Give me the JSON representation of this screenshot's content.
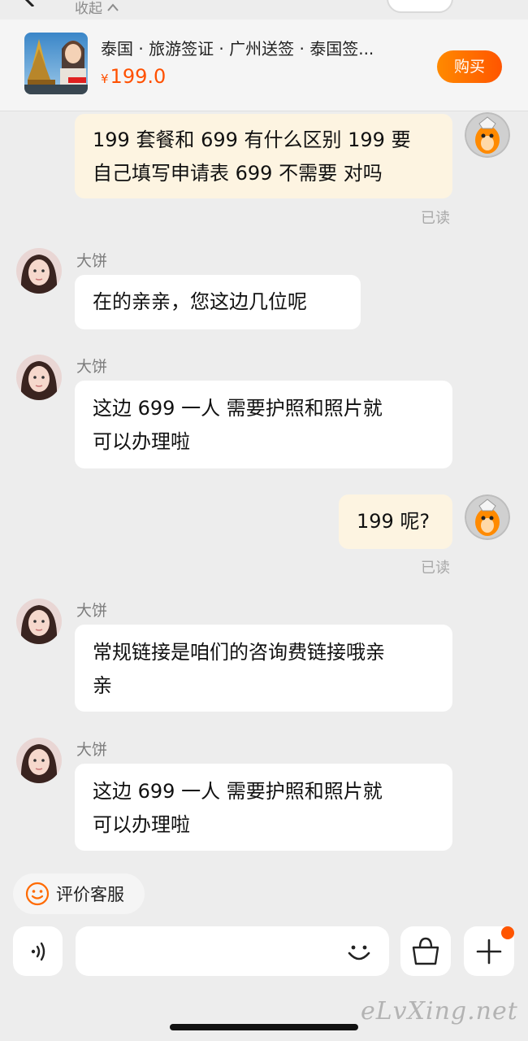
{
  "header": {
    "collapse_label": "收起"
  },
  "product": {
    "title": "泰国 · 旅游签证 · 广州送签 · 泰国签...",
    "currency": "¥",
    "price": "199.0",
    "buy_label": "购买",
    "thumb_caption": "泰国旅游签证"
  },
  "messages": [
    {
      "side": "out",
      "lines": [
        "199 套餐和 699 有什么区别 199 要",
        "自己填写申请表 699 不需要 对吗"
      ],
      "status": "已读"
    },
    {
      "side": "in",
      "sender": "大饼",
      "lines": [
        "在的亲亲，您这边几位呢"
      ]
    },
    {
      "side": "in",
      "sender": "大饼",
      "lines": [
        "这边 699 一人 需要护照和照片就",
        "可以办理啦"
      ]
    },
    {
      "side": "out",
      "lines": [
        "199 呢?"
      ],
      "status": "已读"
    },
    {
      "side": "in",
      "sender": "大饼",
      "lines": [
        "常规链接是咱们的咨询费链接哦亲",
        "亲"
      ]
    },
    {
      "side": "in",
      "sender": "大饼",
      "lines": [
        "这边 699 一人 需要护照和照片就",
        "可以办理啦"
      ]
    }
  ],
  "rate_chip": {
    "label": "评价客服",
    "icon": "smiley-icon"
  },
  "input_bar": {
    "icons": [
      "voice-icon",
      "emoji-icon",
      "shopping-bag-icon",
      "plus-icon"
    ],
    "accent": "#ff5500"
  },
  "watermark": "eLvXing.net",
  "colors": {
    "background": "#ededed",
    "outgoing_bubble": "#fdf4e1",
    "incoming_bubble": "#ffffff",
    "price": "#ff5000"
  }
}
